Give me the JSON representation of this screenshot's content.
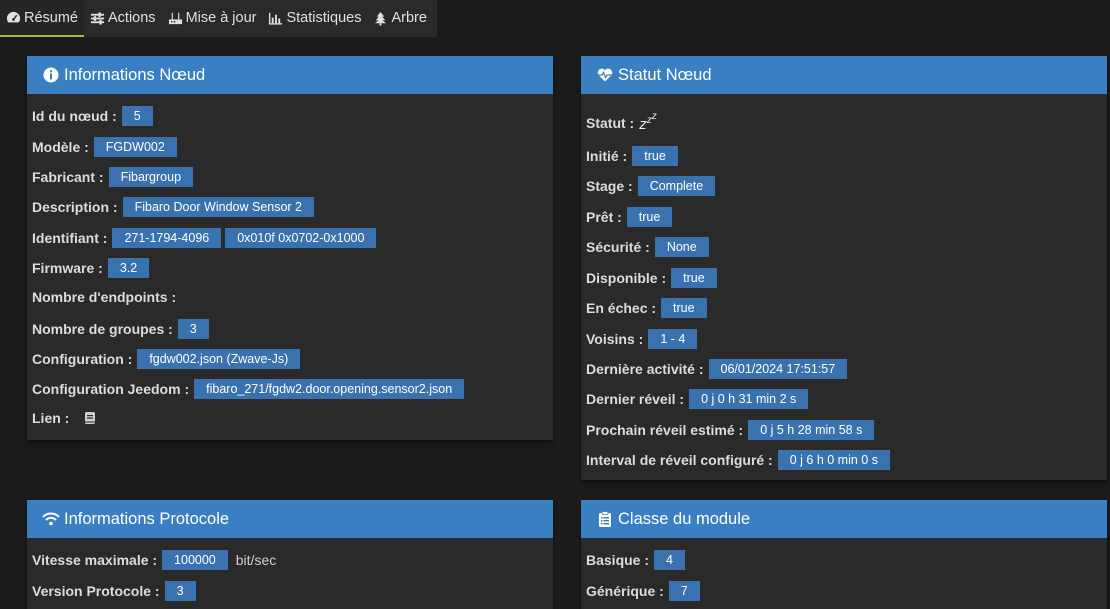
{
  "tabs": [
    {
      "label": "Résumé",
      "icon": "tachometer-icon"
    },
    {
      "label": "Actions",
      "icon": "sliders-icon"
    },
    {
      "label": "Mise à jour",
      "icon": "router-icon"
    },
    {
      "label": "Statistiques",
      "icon": "bar-chart-icon"
    },
    {
      "label": "Arbre",
      "icon": "tree-icon"
    }
  ],
  "node_info": {
    "title": "Informations Nœud",
    "id_label": "Id du nœud :",
    "id_value": "5",
    "model_label": "Modèle :",
    "model_value": "FGDW002",
    "manufacturer_label": "Fabricant :",
    "manufacturer_value": "Fibargroup",
    "description_label": "Description :",
    "description_value": "Fibaro Door Window Sensor 2",
    "identifier_label": "Identifiant :",
    "identifier_value_1": "271-1794-4096",
    "identifier_value_2": "0x010f 0x0702-0x1000",
    "firmware_label": "Firmware :",
    "firmware_value": "3.2",
    "endpoints_label": "Nombre d'endpoints :",
    "groups_label": "Nombre de groupes :",
    "groups_value": "3",
    "config_label": "Configuration :",
    "config_value": "fgdw002.json (Zwave-Js)",
    "jeedom_config_label": "Configuration Jeedom :",
    "jeedom_config_value": "fibaro_271/fgdw2.door.opening.sensor2.json",
    "link_label": "Lien :"
  },
  "node_status": {
    "title": "Statut Nœud",
    "status_label": "Statut :",
    "status_value": "z",
    "status_sup1": "z",
    "status_sup2": "z",
    "init_label": "Initié :",
    "init_value": "true",
    "stage_label": "Stage :",
    "stage_value": "Complete",
    "ready_label": "Prêt :",
    "ready_value": "true",
    "security_label": "Sécurité :",
    "security_value": "None",
    "available_label": "Disponible :",
    "available_value": "true",
    "failed_label": "En échec :",
    "failed_value": "true",
    "neighbors_label": "Voisins :",
    "neighbors_value": "1 - 4",
    "last_activity_label": "Dernière activité :",
    "last_activity_value": "06/01/2024 17:51:57",
    "last_wakeup_label": "Dernier réveil :",
    "last_wakeup_value": "0 j 0 h 31 min 2 s",
    "next_wakeup_label": "Prochain réveil estimé :",
    "next_wakeup_value": "0 j 5 h 28 min 58 s",
    "wakeup_interval_label": "Interval de réveil configuré :",
    "wakeup_interval_value": "0 j 6 h 0 min 0 s"
  },
  "protocol_info": {
    "title": "Informations Protocole",
    "max_speed_label": "Vitesse maximale :",
    "max_speed_value": "100000",
    "max_speed_unit": "bit/sec",
    "protocol_version_label": "Version Protocole :",
    "protocol_version_value": "3"
  },
  "module_class": {
    "title": "Classe du module",
    "basic_label": "Basique :",
    "basic_value": "4",
    "generic_label": "Générique :",
    "generic_value": "7"
  },
  "colors": {
    "accent": "#3a7fc1",
    "badge": "#3a72b0",
    "active_tab_underline": "#9abf3a",
    "panel_bg": "#2a2a2a",
    "page_bg": "#1b1b1b"
  }
}
